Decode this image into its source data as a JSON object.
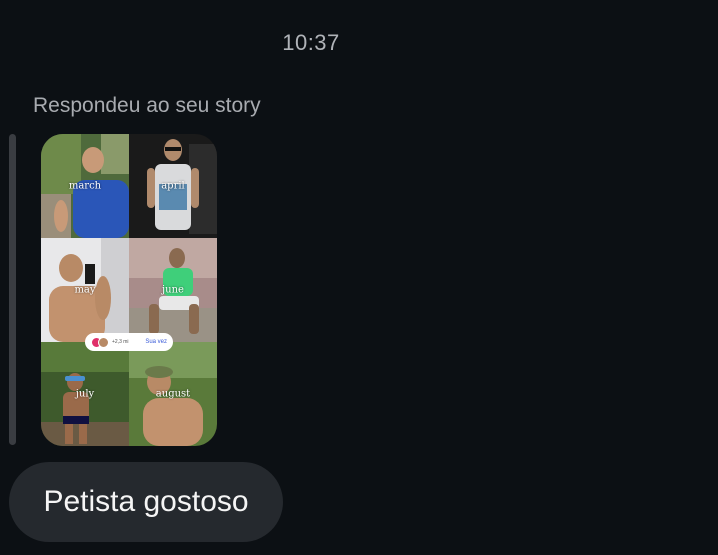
{
  "chat": {
    "timestamp": "10:37",
    "reply_label": "Respondeu ao seu story",
    "message": "Petista gostoso"
  },
  "story": {
    "months": [
      "march",
      "april",
      "may",
      "june",
      "july",
      "august"
    ],
    "pill": {
      "count": "+2,3 mi",
      "action": "Sua vez"
    }
  },
  "colors": {
    "background": "#0c1014",
    "bubble": "#25292e",
    "reply_bar": "#3a3d42",
    "muted_text": "#a8abb0"
  }
}
